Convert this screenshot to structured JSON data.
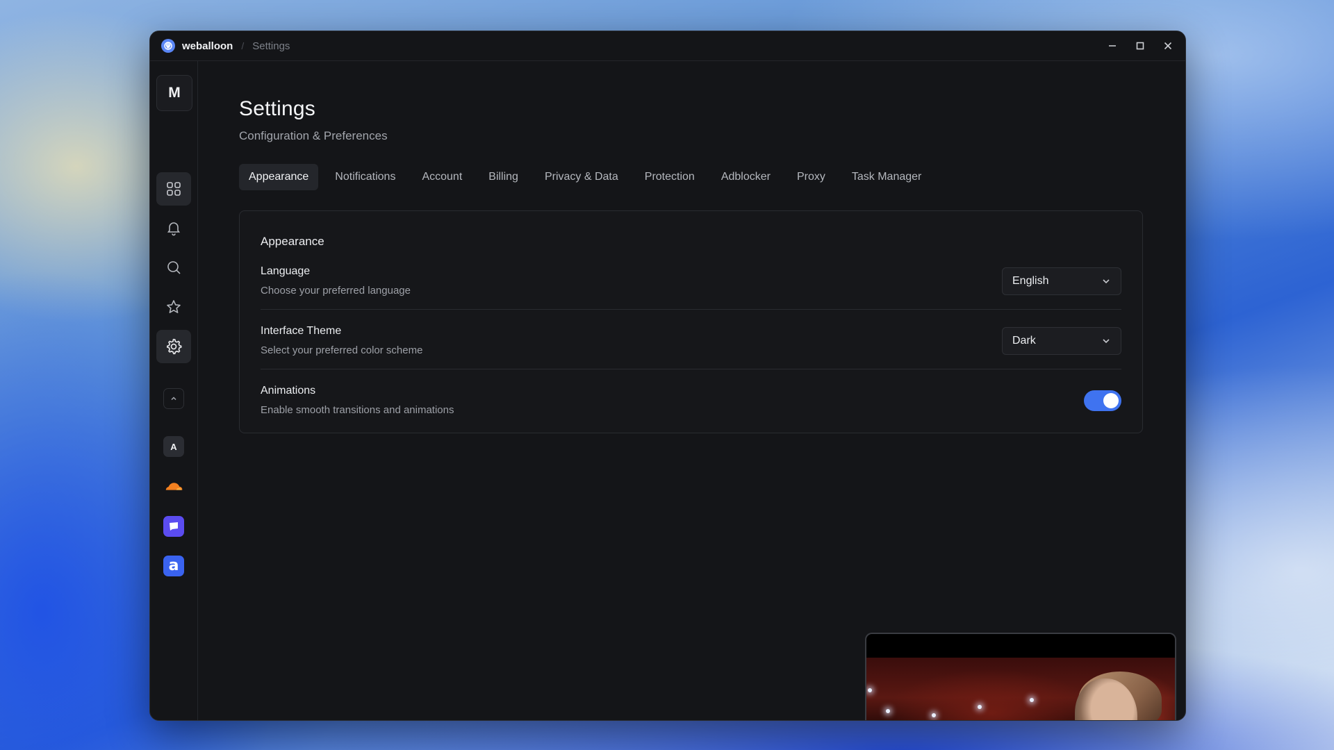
{
  "titlebar": {
    "app_name": "weballoon",
    "breadcrumb": "Settings",
    "controls": [
      "minimize-icon",
      "maximize-icon",
      "close-icon"
    ]
  },
  "sidebar": {
    "avatar_letter": "M",
    "nav_icons": [
      "grid-icon",
      "bell-icon",
      "search-icon",
      "star-icon",
      "gear-icon"
    ],
    "active_item": "gear-icon",
    "collapse_icon": "chevron-up-icon",
    "apps": [
      {
        "name": "a-app-icon",
        "letter": "A",
        "color": "#2b2d33"
      },
      {
        "name": "cloudflare-app-icon",
        "color": "#f38020"
      },
      {
        "name": "chat-app-icon",
        "color": "#5b4cf0"
      },
      {
        "name": "a-bracket-app-icon",
        "letter": "a",
        "color": "#3a63f0"
      }
    ]
  },
  "page": {
    "title": "Settings",
    "subtitle": "Configuration & Preferences"
  },
  "tabs": [
    {
      "label": "Appearance",
      "active": true
    },
    {
      "label": "Notifications",
      "active": false
    },
    {
      "label": "Account",
      "active": false
    },
    {
      "label": "Billing",
      "active": false
    },
    {
      "label": "Privacy & Data",
      "active": false
    },
    {
      "label": "Protection",
      "active": false
    },
    {
      "label": "Adblocker",
      "active": false
    },
    {
      "label": "Proxy",
      "active": false
    },
    {
      "label": "Task Manager",
      "active": false
    }
  ],
  "panel": {
    "title": "Appearance",
    "rows": [
      {
        "label": "Language",
        "description": "Choose your preferred language",
        "control": "select",
        "value": "English"
      },
      {
        "label": "Interface Theme",
        "description": "Select your preferred color scheme",
        "control": "select",
        "value": "Dark"
      },
      {
        "label": "Animations",
        "description": "Enable smooth transitions and animations",
        "control": "toggle",
        "value": true
      }
    ]
  },
  "colors": {
    "accent": "#3f73f0",
    "window_bg": "#141518",
    "panel_bg": "#16171a"
  }
}
